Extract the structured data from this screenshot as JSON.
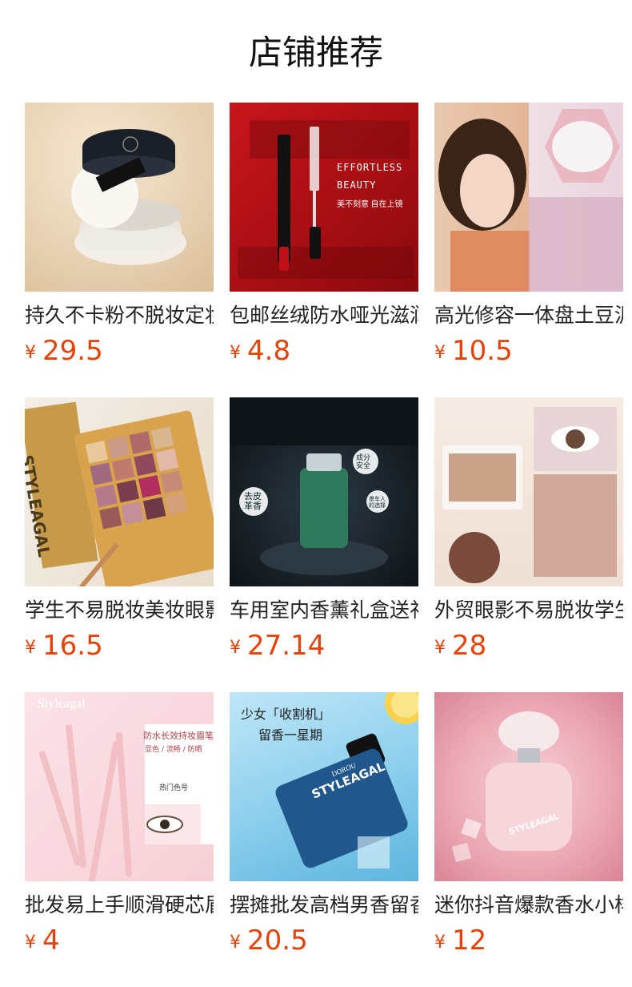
{
  "page_title": "店铺推荐",
  "currency": "¥",
  "products": [
    {
      "name": "持久不卡粉不脱妆定妆散粉",
      "price": "29.5",
      "image_icon": "loose-powder-image"
    },
    {
      "name": "包邮丝绒防水哑光滋润口红",
      "price": "4.8",
      "image_icon": "lipstick-image",
      "overlay_en_1": "EFFORTLESS",
      "overlay_en_2": "BEAUTY",
      "overlay_cn": "美不刻意 自在上镜"
    },
    {
      "name": "高光修容一体盘土豆泥高光",
      "price": "10.5",
      "image_icon": "highlighter-image"
    },
    {
      "name": "学生不易脱妆美妆眼影盘",
      "price": "16.5",
      "image_icon": "eyeshadow-palette-image",
      "overlay_brand": "STYLEAGAL"
    },
    {
      "name": "车用室内香薰礼盒送礼",
      "price": "27.14",
      "image_icon": "car-perfume-image",
      "overlay_1": "去皮革香",
      "overlay_2": "成分安全",
      "overlay_3": "墨车人的选择"
    },
    {
      "name": "外贸眼影不易脱妆学生党",
      "price": "28",
      "image_icon": "eyeshadow-swatch-image"
    },
    {
      "name": "批发易上手顺滑硬芯眉笔",
      "price": "4",
      "image_icon": "eyebrow-pencil-image",
      "overlay_brand": "Styleagal",
      "overlay_title": "防水长效持妆眉笔",
      "overlay_sub": "显色 / 流畅 / 防晒",
      "overlay_tag": "热门色号"
    },
    {
      "name": "摆摊批发高档男香留香持久",
      "price": "20.5",
      "image_icon": "mens-perfume-image",
      "overlay_line1": "少女「收割机」",
      "overlay_line2": "留香一星期",
      "overlay_brand": "STYLEAGAL",
      "overlay_sub": "DOROU"
    },
    {
      "name": "迷你抖音爆款香水小样",
      "price": "12",
      "image_icon": "womens-perfume-image",
      "overlay_brand": "STYLEAGAL"
    }
  ]
}
